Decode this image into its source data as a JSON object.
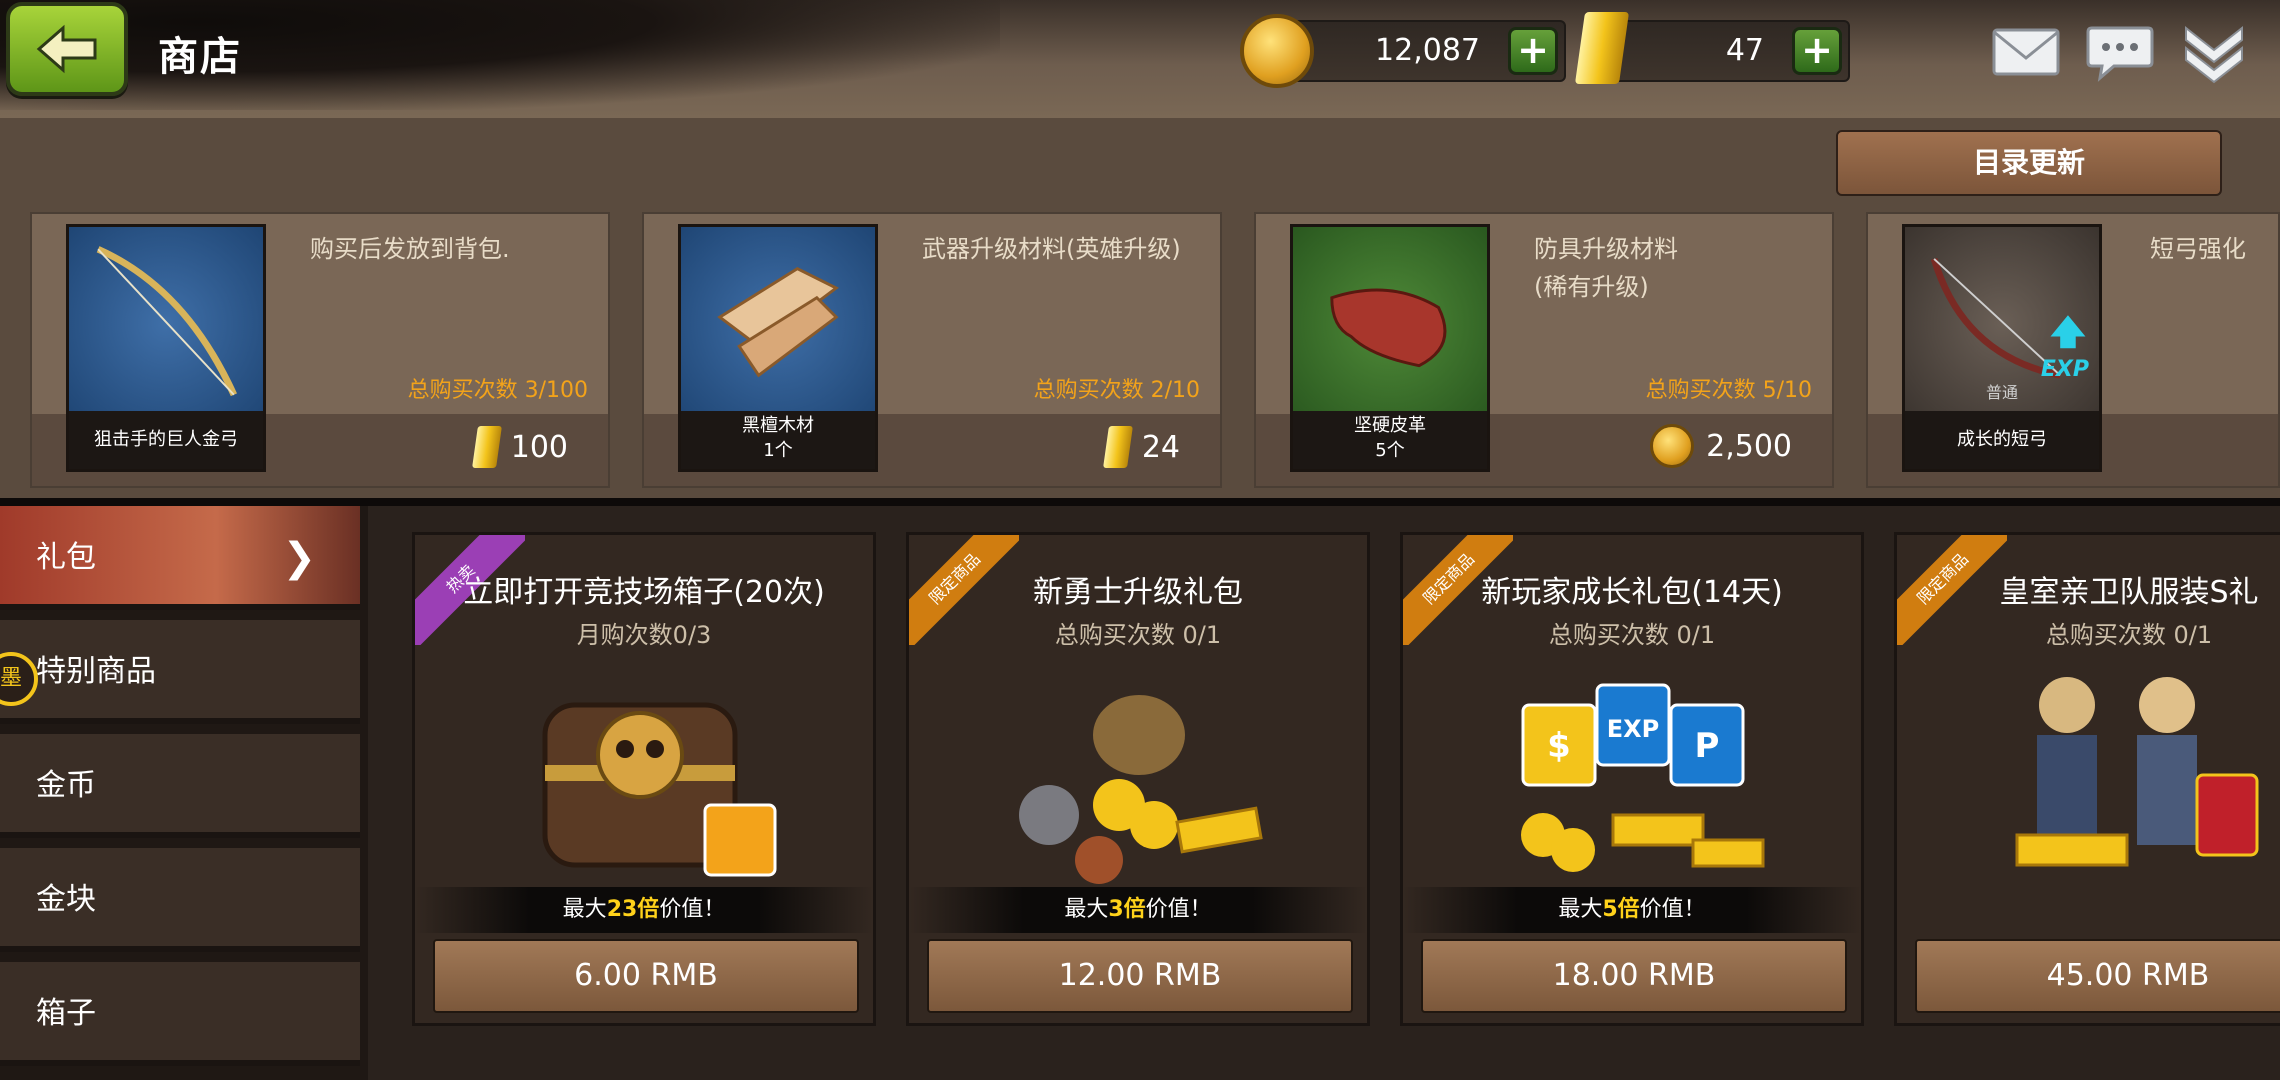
{
  "header": {
    "title": "商店"
  },
  "currency": {
    "coins": "12,087",
    "gold": "47"
  },
  "catalog": {
    "refresh_label": "目录更新",
    "items": [
      {
        "desc1": "购买后发放到背包.",
        "desc2": "",
        "item_label": "狙击手的巨人金弓",
        "count": "总购买次数 3/100",
        "price": "100",
        "currency": "gold"
      },
      {
        "desc1": "武器升级材料(英雄升级)",
        "desc2": "",
        "item_label": "黑檀木材",
        "item_qty": "1个",
        "count": "总购买次数 2/10",
        "price": "24",
        "currency": "gold"
      },
      {
        "desc1": "防具升级材料",
        "desc2": "(稀有升级)",
        "item_label": "坚硬皮革",
        "item_qty": "5个",
        "count": "总购买次数 5/10",
        "price": "2,500",
        "currency": "coin"
      },
      {
        "desc1": "短弓强化",
        "desc2": "",
        "item_label": "成长的短弓",
        "item_grade": "普通",
        "exp_badge": "EXP"
      }
    ]
  },
  "sidebar": {
    "tabs": [
      "礼包",
      "特别商品",
      "金币",
      "金块",
      "箱子"
    ],
    "badge": "墨"
  },
  "packs": [
    {
      "ribbon": "热卖",
      "title": "立即打开竞技场箱子(20次)",
      "sub": "月购次数0/3",
      "value_pre": "最大",
      "value_num": "23倍",
      "value_post": "价值！",
      "price": "6.00 RMB"
    },
    {
      "ribbon": "限定商品",
      "title": "新勇士升级礼包",
      "sub": "总购买次数 0/1",
      "value_pre": "最大",
      "value_num": "3倍",
      "value_post": "价值！",
      "price": "12.00 RMB"
    },
    {
      "ribbon": "限定商品",
      "title": "新玩家成长礼包(14天)",
      "sub": "总购买次数 0/1",
      "value_pre": "最大",
      "value_num": "5倍",
      "value_post": "价值！",
      "price": "18.00 RMB"
    },
    {
      "ribbon": "限定商品",
      "title": "皇室亲卫队服装S礼",
      "sub": "总购买次数 0/1",
      "price": "45.00 RMB"
    }
  ],
  "pack3_icons": [
    "$",
    "EXP",
    "P"
  ],
  "colors": {
    "accent_orange": "#f3a31a",
    "highlight_yellow": "#ffd21a",
    "active_tab": "#c56a4a"
  }
}
